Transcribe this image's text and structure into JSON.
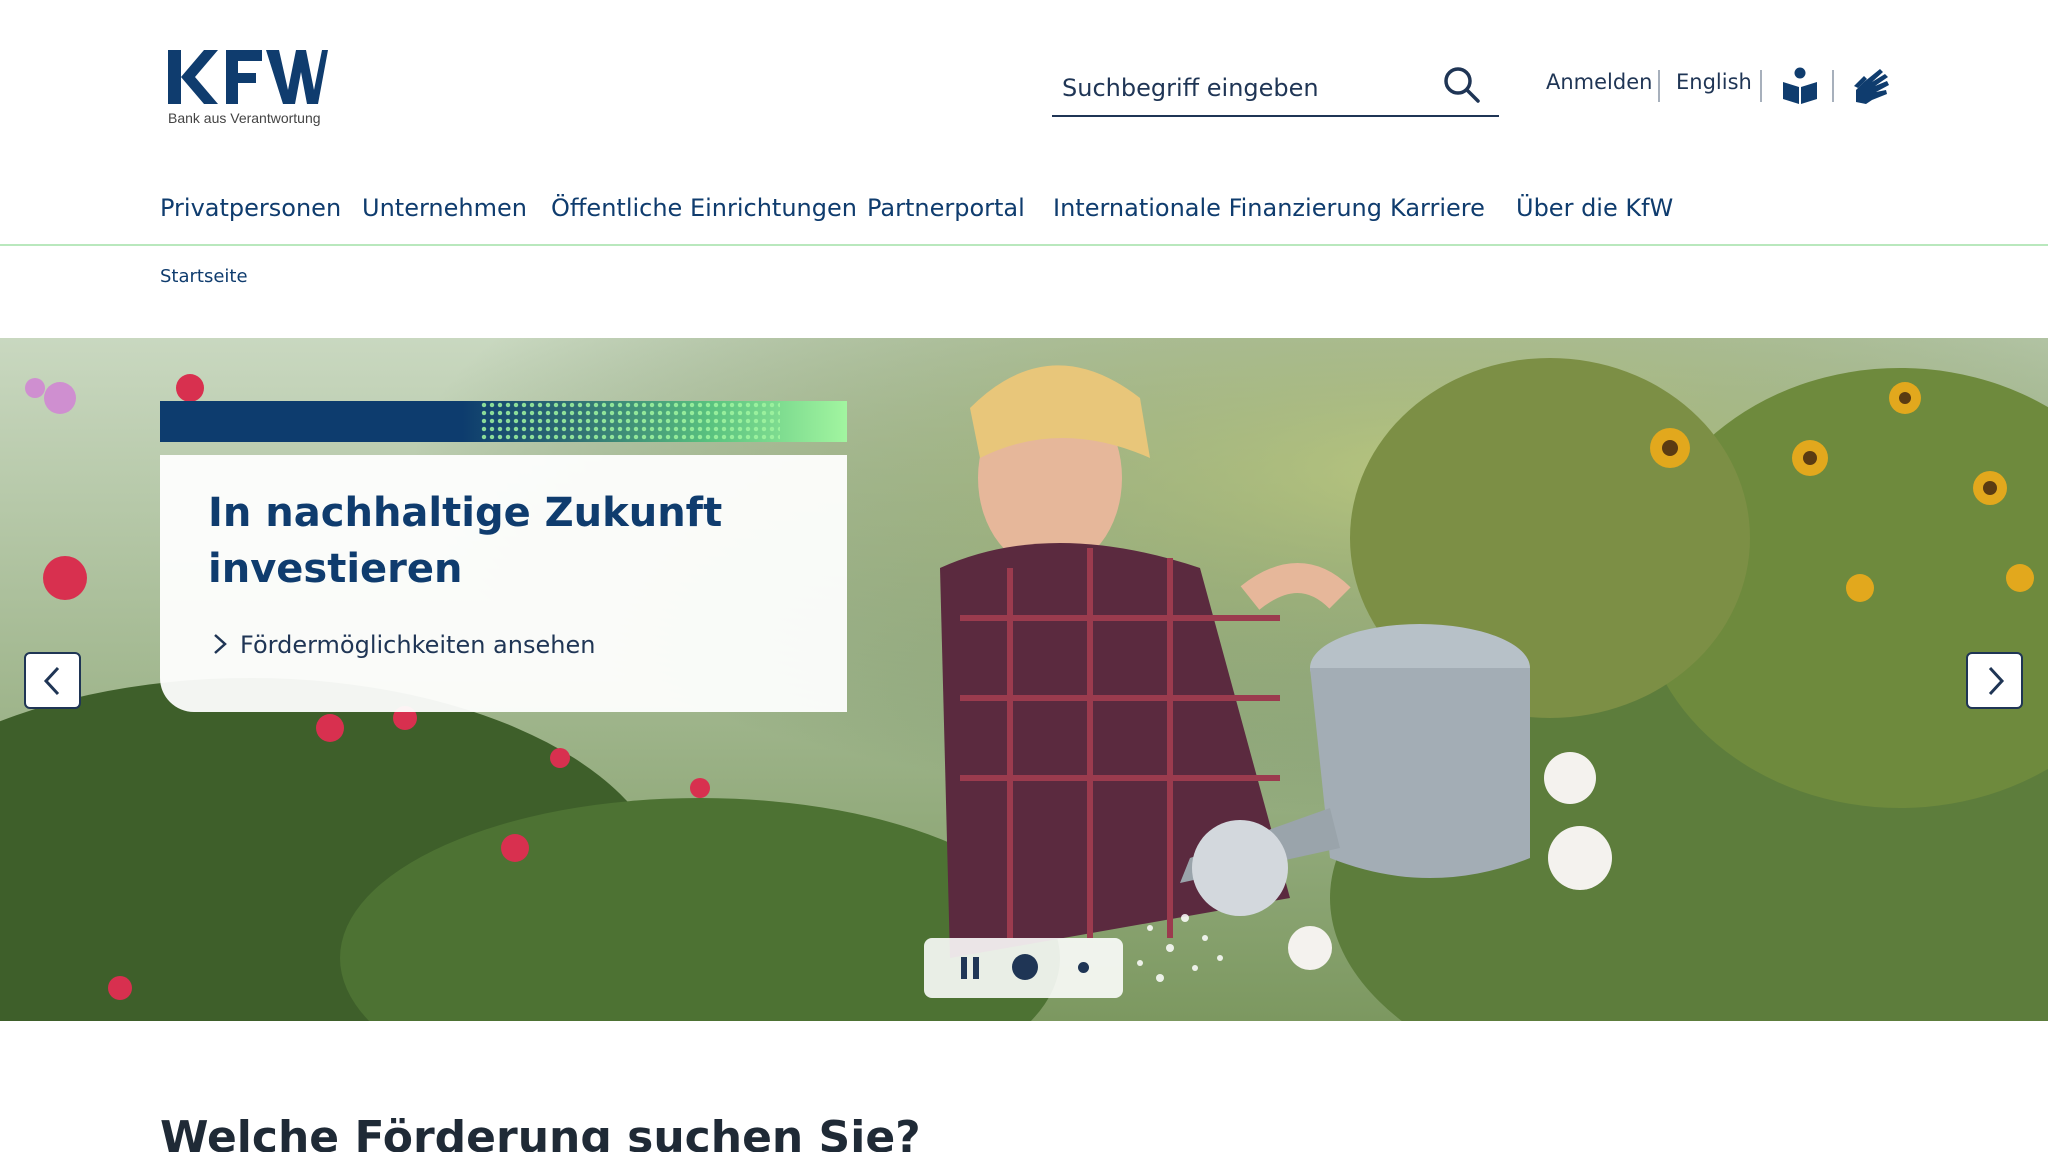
{
  "logo": {
    "wordmark": "KFW",
    "tagline": "Bank aus Verantwortung"
  },
  "search": {
    "placeholder": "Suchbegriff eingeben",
    "icon": "search-icon"
  },
  "utility_nav": {
    "login": "Anmelden",
    "language": "English",
    "icons": [
      "easy-language-icon",
      "sign-language-icon"
    ]
  },
  "main_nav": {
    "items": [
      {
        "label": "Privatpersonen"
      },
      {
        "label": "Unternehmen"
      },
      {
        "label": "Öffentliche Einrichtungen"
      },
      {
        "label": "Partnerportal"
      },
      {
        "label": "Internationale Finanzierung"
      },
      {
        "label": "Karriere"
      },
      {
        "label": "Über die KfW"
      }
    ]
  },
  "breadcrumb": {
    "home": "Startseite"
  },
  "hero": {
    "title": "In nachhaltige Zukunft investieren",
    "cta": "Fördermöglichkeiten ansehen",
    "slides_total": 2,
    "active_slide": 1,
    "colors": {
      "navy": "#0f3c6e",
      "accent_green": "#a2f5a0"
    }
  },
  "section": {
    "heading": "Welche Förderung suchen Sie?"
  }
}
